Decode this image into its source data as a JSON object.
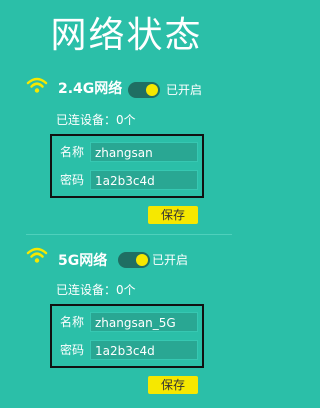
{
  "page": {
    "title": "网络状态"
  },
  "bands": [
    {
      "name": "2.4G网络",
      "toggle_status": "已开启",
      "toggle_on": true,
      "connected_devices": "已连设备：0个",
      "ssid_label": "名称",
      "ssid_value": "zhangsan",
      "password_label": "密码",
      "password_value": "1a2b3c4d",
      "save_label": "保存"
    },
    {
      "name": "5G网络",
      "toggle_status": "已开启",
      "toggle_on": true,
      "connected_devices": "已连设备：0个",
      "ssid_label": "名称",
      "ssid_value": "zhangsan_5G",
      "password_label": "密码",
      "password_value": "1a2b3c4d",
      "save_label": "保存"
    }
  ],
  "colors": {
    "background": "#2bbfa8",
    "accent": "#f6e800",
    "input_fill": "#29a793",
    "toggle_track": "#1f6f63"
  },
  "icons": {
    "band_icon": "wifi-icon"
  }
}
